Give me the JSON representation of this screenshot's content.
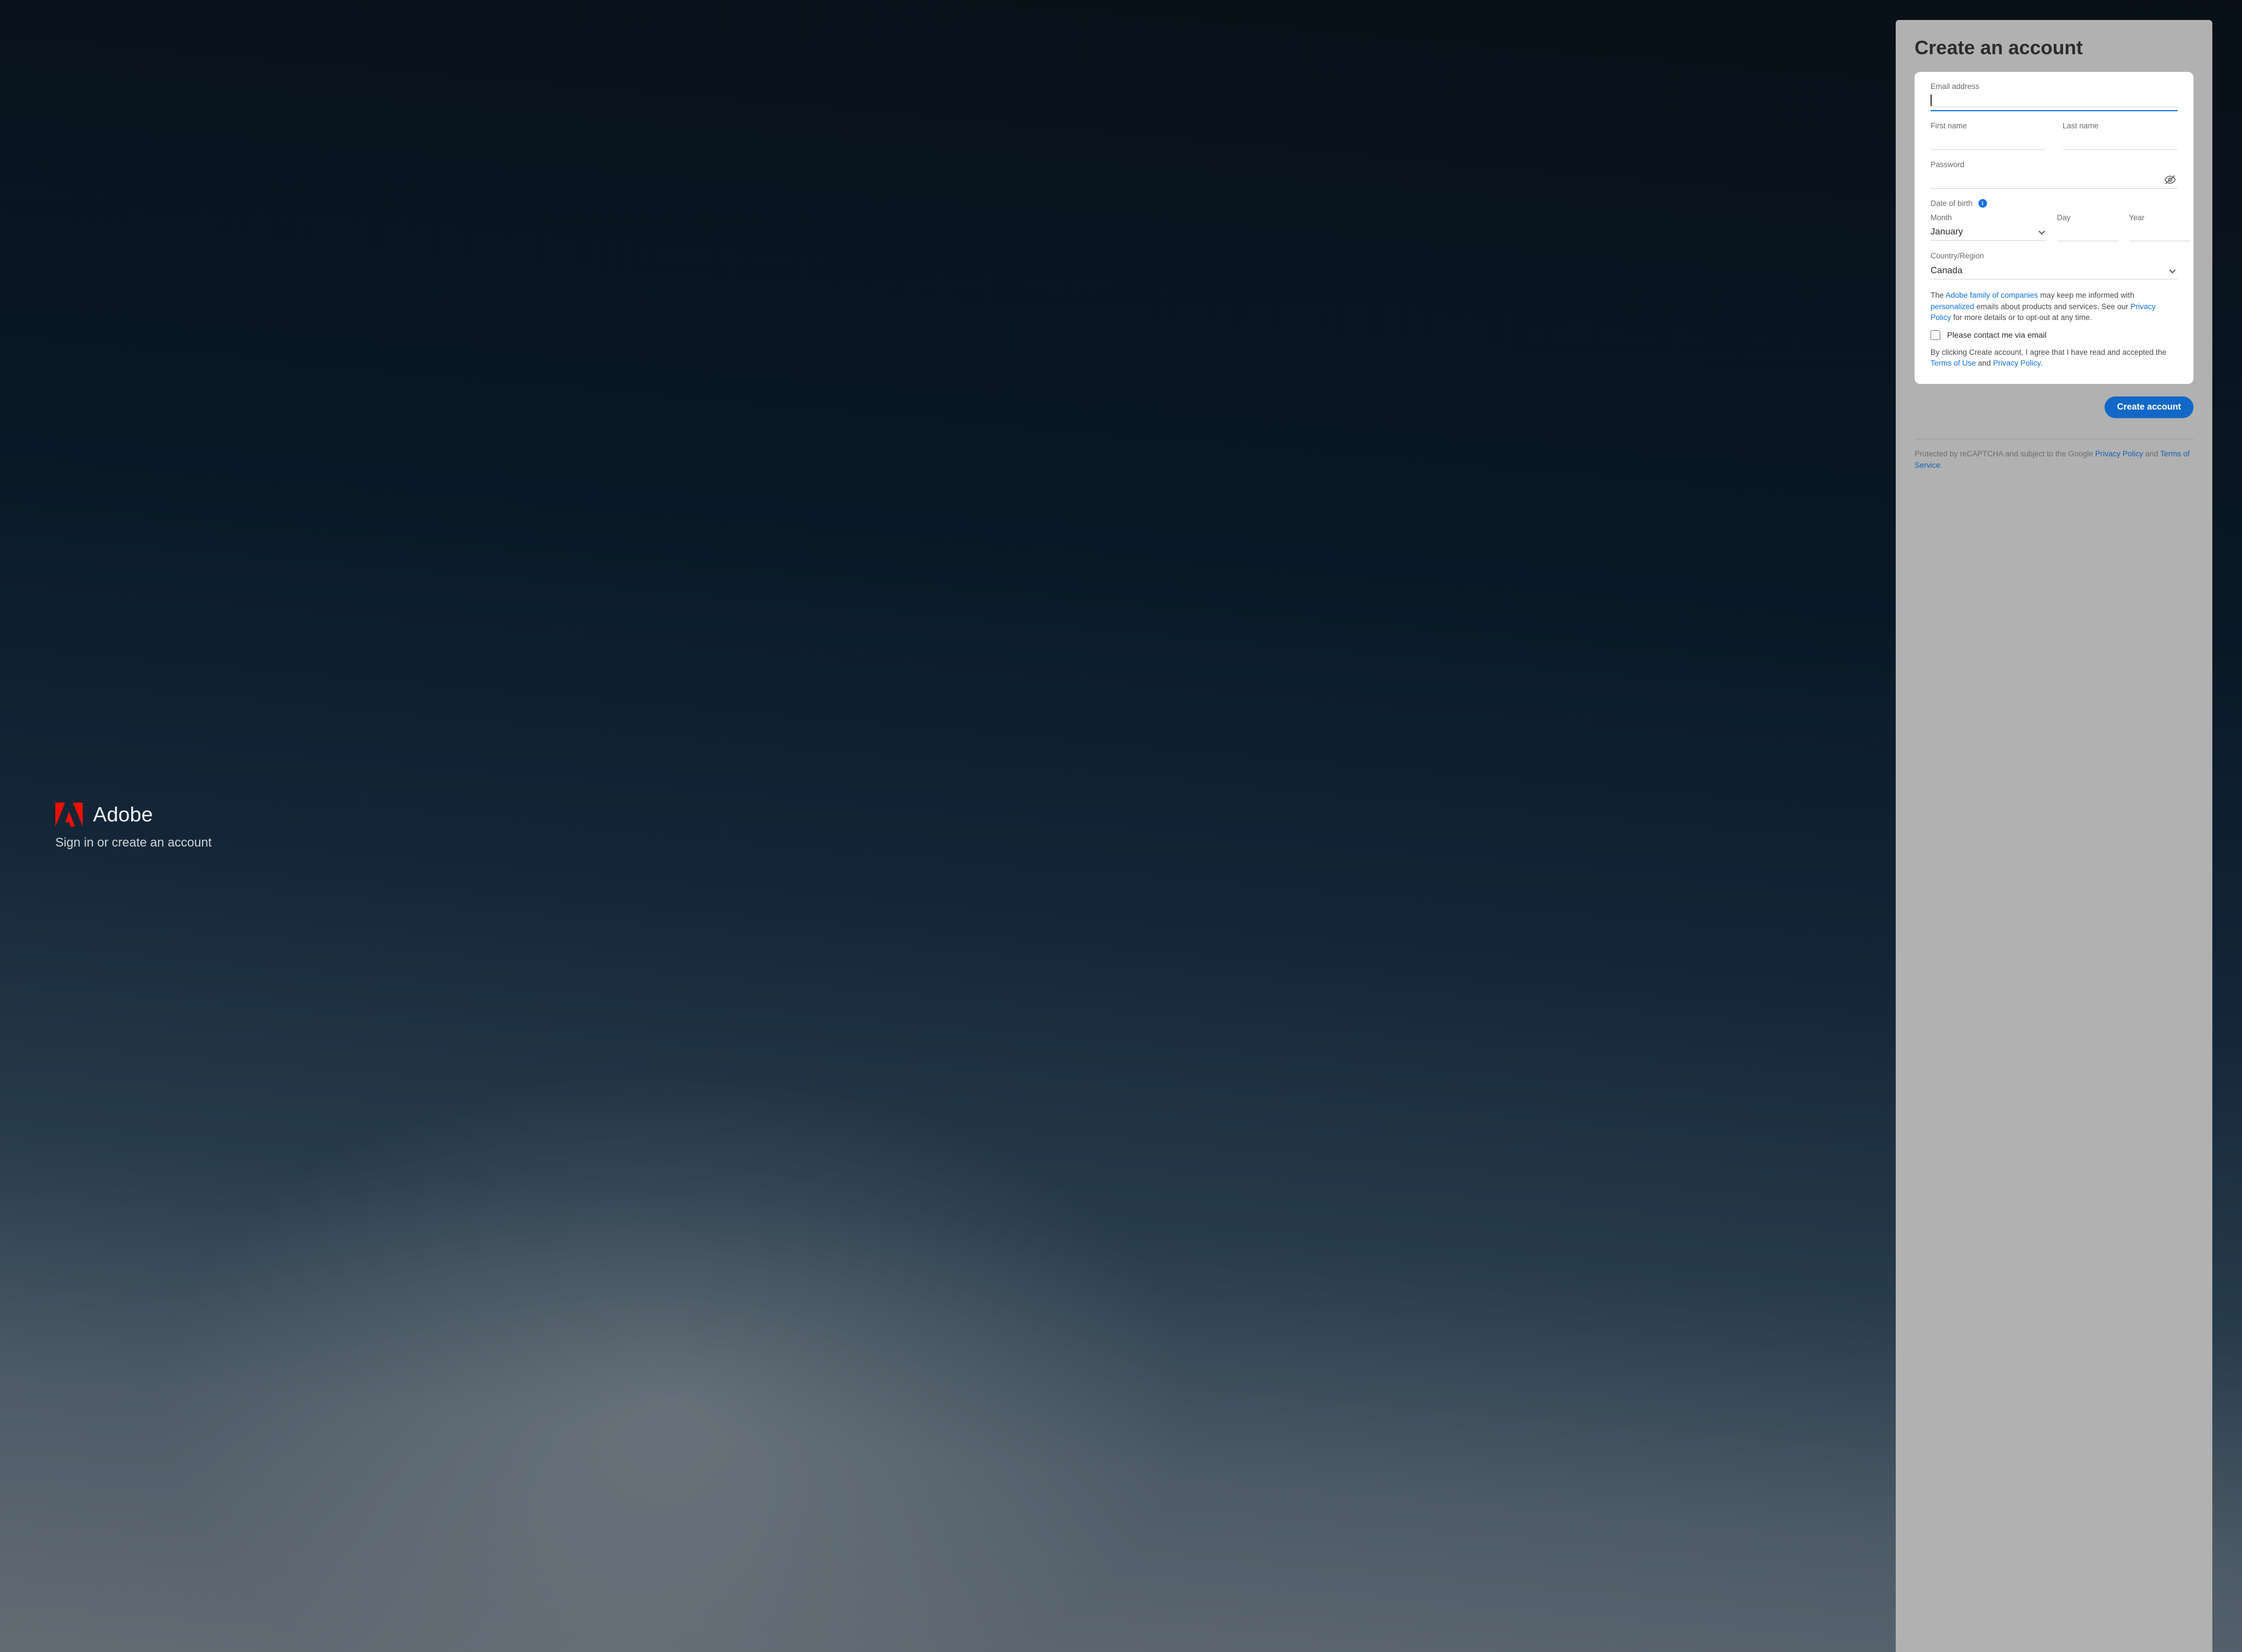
{
  "brand": {
    "name": "Adobe",
    "tagline": "Sign in or create an account"
  },
  "panel": {
    "title": "Create an account",
    "labels": {
      "email": "Email address",
      "first_name": "First name",
      "last_name": "Last name",
      "password": "Password",
      "dob": "Date of birth",
      "month": "Month",
      "day": "Day",
      "year": "Year",
      "country": "Country/Region"
    },
    "values": {
      "email": "",
      "first_name": "",
      "last_name": "",
      "password": "",
      "month": "January",
      "day": "",
      "year": "",
      "country": "Canada"
    },
    "disclosure": {
      "pre_companies": "The ",
      "companies_link": "Adobe family of companies",
      "mid1": " may keep me informed with ",
      "personalized_link": "personalized",
      "mid2": " emails about products and services. See our ",
      "privacy_link": "Privacy Policy",
      "post": " for more details or to opt-out at any time."
    },
    "checkbox_label": "Please contact me via email",
    "agreement": {
      "pre": "By clicking Create account, I agree that I have read and accepted the ",
      "terms_link": "Terms of Use",
      "and": " and ",
      "privacy_link": "Privacy Policy",
      "period": "."
    },
    "cta": "Create account",
    "footnote": {
      "pre": "Protected by reCAPTCHA and subject to the Google ",
      "privacy_link": "Privacy Policy",
      "and": " and ",
      "terms_link": "Terms of Service",
      "period": "."
    }
  }
}
